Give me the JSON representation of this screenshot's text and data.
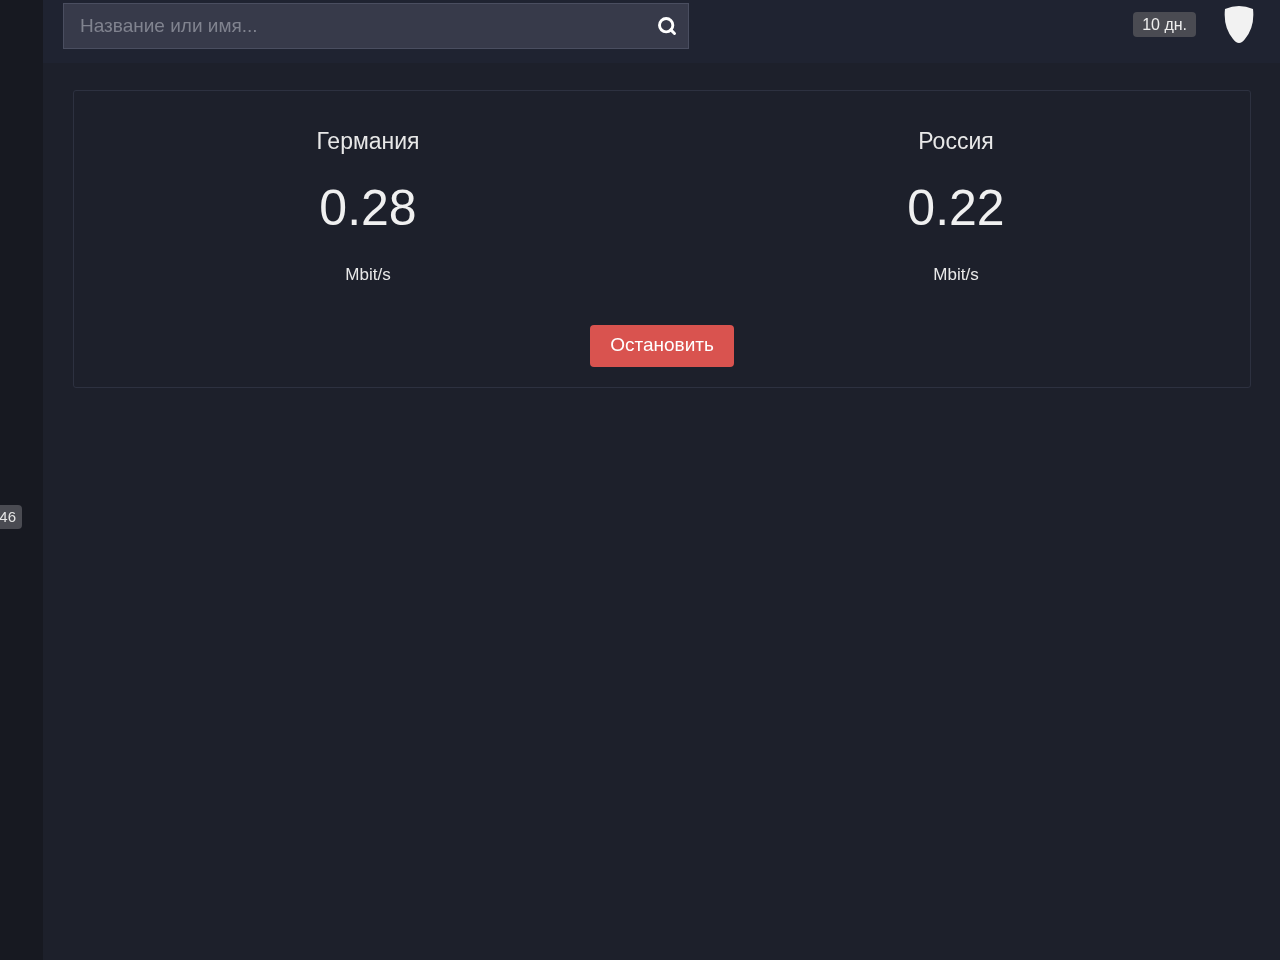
{
  "sidebar": {
    "badge": "46"
  },
  "header": {
    "search": {
      "placeholder": "Название или имя..."
    },
    "days_badge": "10 дн."
  },
  "speed_card": {
    "servers": [
      {
        "country": "Германия",
        "speed": "0.28",
        "unit": "Mbit/s"
      },
      {
        "country": "Россия",
        "speed": "0.22",
        "unit": "Mbit/s"
      }
    ],
    "stop_button": "Остановить"
  }
}
